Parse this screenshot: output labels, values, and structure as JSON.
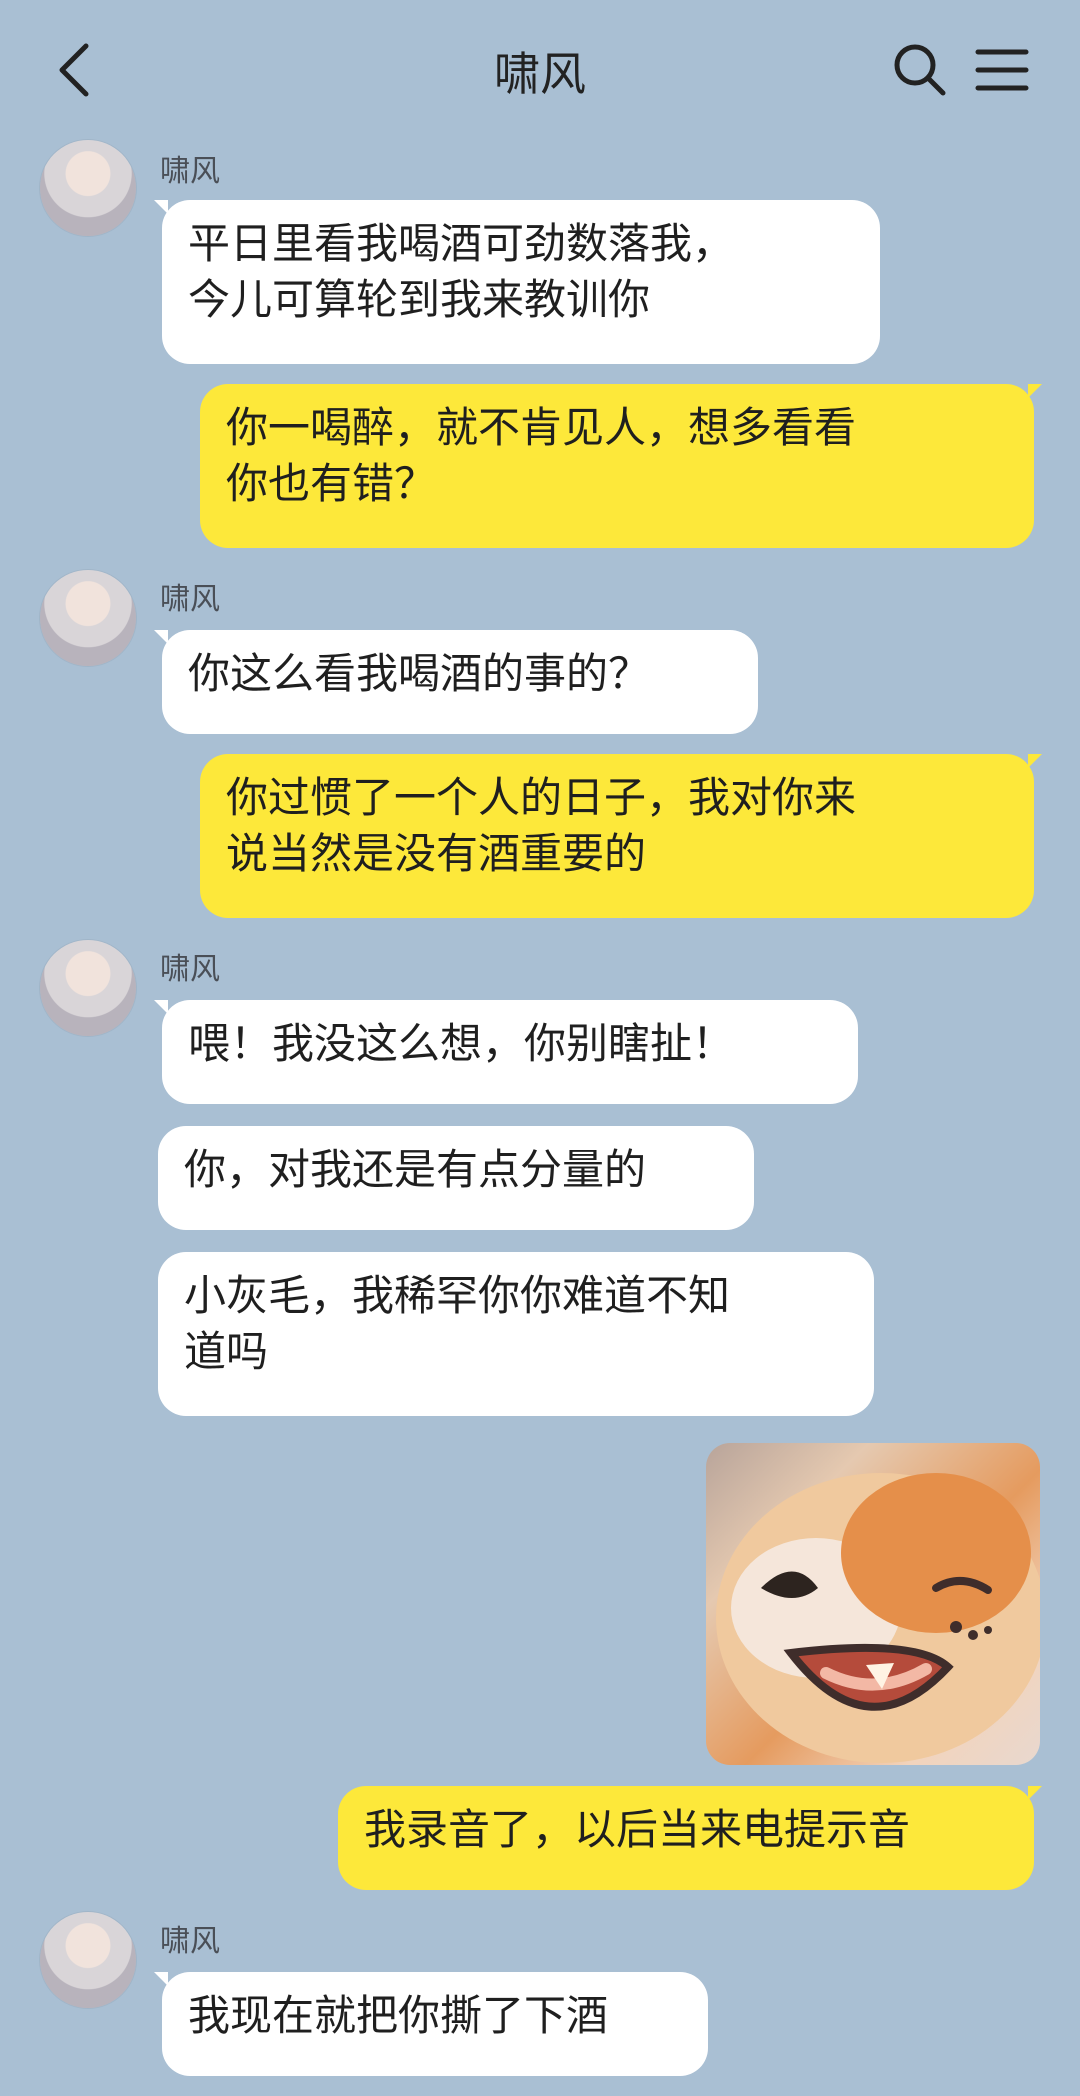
{
  "header": {
    "back_icon": "chevron-left-icon",
    "title": "啸风",
    "search_icon": "search-icon",
    "menu_icon": "menu-icon"
  },
  "messages": [
    {
      "side": "left",
      "sender": "啸风",
      "text": "平日里看我喝酒可劲数落我，\n今儿可算轮到我来教训你"
    },
    {
      "side": "right",
      "text": "你一喝醉，就不肯见人，想多看看\n你也有错？"
    },
    {
      "side": "left",
      "sender": "啸风",
      "text": "你这么看我喝酒的事的？"
    },
    {
      "side": "right",
      "text": "你过惯了一个人的日子，我对你来\n说当然是没有酒重要的"
    },
    {
      "side": "left",
      "sender": "啸风",
      "text": "喂！我没这么想，你别瞎扯！"
    },
    {
      "side": "left",
      "text": "你，对我还是有点分量的"
    },
    {
      "side": "left",
      "text": "小灰毛，我稀罕你你难道不知\n道吗"
    },
    {
      "side": "right",
      "type": "sticker",
      "icon": "smiling-dog-sticker"
    },
    {
      "side": "right",
      "text": "我录音了，以后当来电提示音"
    },
    {
      "side": "left",
      "sender": "啸风",
      "text": "我现在就把你撕了下酒"
    }
  ],
  "colors": {
    "background": "#a9bfd3",
    "incoming": "#ffffff",
    "outgoing": "#fde83a"
  }
}
